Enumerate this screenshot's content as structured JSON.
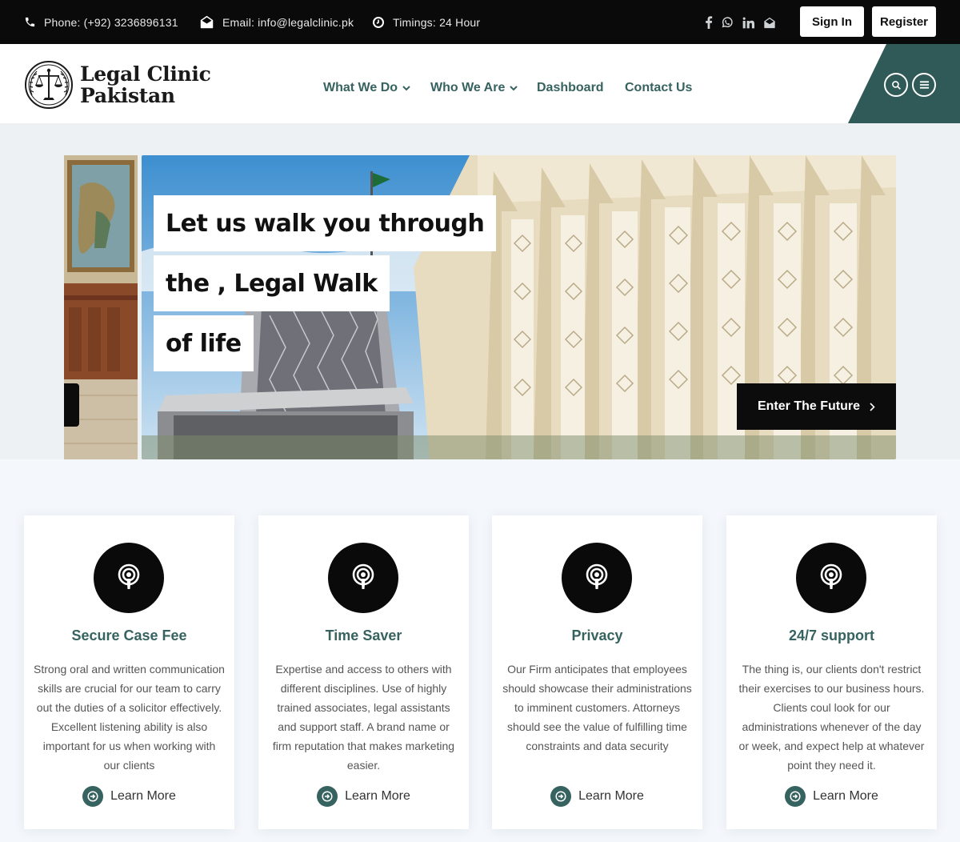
{
  "topbar": {
    "phone": "Phone: (+92) 3236896131",
    "email": "Email: info@legalclinic.pk",
    "timings": "Timings: 24 Hour",
    "social_icons": [
      "facebook-icon",
      "whatsapp-icon",
      "linkedin-icon",
      "mail-open-icon"
    ],
    "signin_label": "Sign In",
    "register_label": "Register"
  },
  "header": {
    "logo_line1": "Legal Clinic",
    "logo_line2": "Pakistan",
    "nav": [
      {
        "label": "What We Do",
        "dropdown": true
      },
      {
        "label": "Who We Are",
        "dropdown": true
      },
      {
        "label": "Dashboard",
        "dropdown": false
      },
      {
        "label": "Contact Us",
        "dropdown": false
      }
    ],
    "accent_color": "#2f5a57"
  },
  "hero": {
    "headline": [
      "Let us walk you through",
      "the , Legal Walk",
      "of life"
    ],
    "cta_label": "Enter The Future"
  },
  "features": [
    {
      "title": "Secure Case Fee",
      "text": "Strong oral and written communication skills are crucial for our team to carry out the duties of a solicitor effectively. Excellent listening ability is also important for us when working with our clients",
      "link": "Learn More",
      "icon": "podcast-icon"
    },
    {
      "title": "Time Saver",
      "text": "Expertise and access to others with different disciplines. Use of highly trained associates, legal assistants and support staff. A brand name or firm reputation that makes marketing easier.",
      "link": "Learn More",
      "icon": "podcast-icon"
    },
    {
      "title": "Privacy",
      "text": "Our Firm anticipates that employees should showcase their administrations to imminent customers. Attorneys should see the value of fulfilling time constraints and data security",
      "link": "Learn More",
      "icon": "podcast-icon"
    },
    {
      "title": "24/7 support",
      "text": "The thing is, our clients don't restrict their exercises to our business hours. Clients coul look for our administrations whenever of the day or week, and expect help at whatever point they need it.",
      "link": "Learn More",
      "icon": "podcast-icon"
    }
  ],
  "colors": {
    "brand_green": "#36625f",
    "dark": "#0a0a0a"
  }
}
